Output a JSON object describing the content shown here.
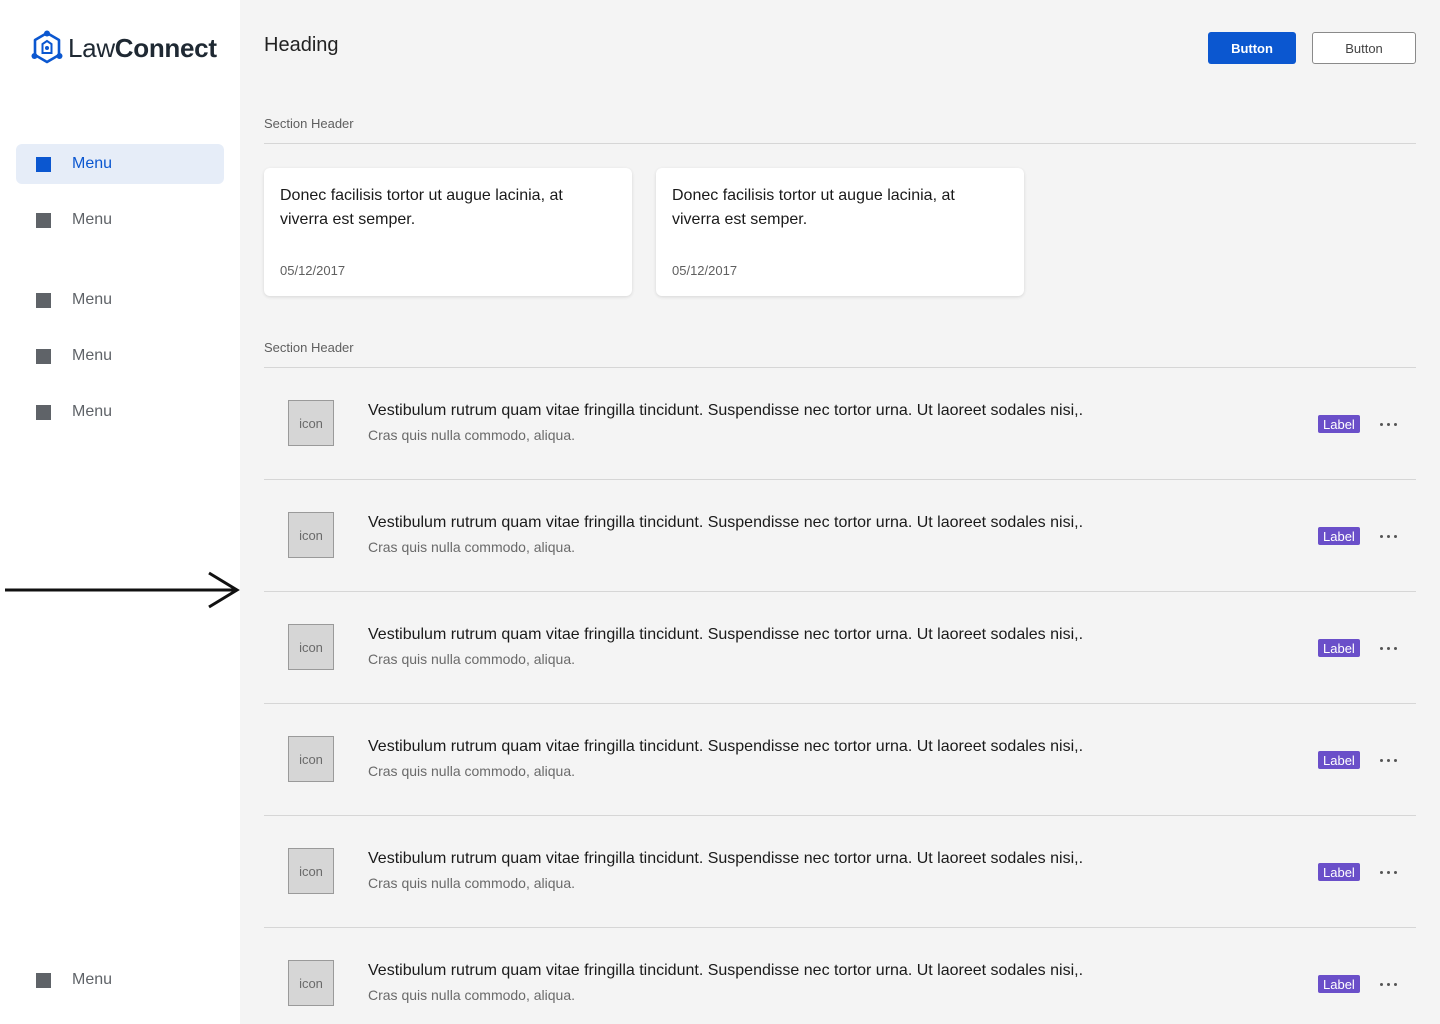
{
  "brand": {
    "name_light": "Law",
    "name_bold": "Connect",
    "color": "#0b57d0"
  },
  "sidebar": {
    "items": [
      {
        "label": "Menu",
        "active": true
      },
      {
        "label": "Menu",
        "active": false
      },
      {
        "label": "Menu",
        "active": false
      },
      {
        "label": "Menu",
        "active": false
      },
      {
        "label": "Menu",
        "active": false
      }
    ],
    "footer_item": {
      "label": "Menu"
    }
  },
  "header": {
    "title": "Heading",
    "primary_button": "Button",
    "secondary_button": "Button"
  },
  "sections": [
    {
      "title": "Section Header"
    },
    {
      "title": "Section Header"
    }
  ],
  "cards": [
    {
      "text": "Donec facilisis tortor ut augue lacinia, at viverra est semper.",
      "date": "05/12/2017"
    },
    {
      "text": "Donec facilisis tortor ut augue lacinia, at viverra est semper.",
      "date": "05/12/2017"
    }
  ],
  "list": {
    "items": [
      {
        "icon_text": "icon",
        "title": "Vestibulum rutrum quam vitae fringilla tincidunt. Suspendisse nec tortor urna. Ut laoreet sodales nisi,.",
        "subtitle": "Cras quis nulla commodo, aliqua.",
        "label": "Label"
      },
      {
        "icon_text": "icon",
        "title": "Vestibulum rutrum quam vitae fringilla tincidunt. Suspendisse nec tortor urna. Ut laoreet sodales nisi,.",
        "subtitle": "Cras quis nulla commodo, aliqua.",
        "label": "Label"
      },
      {
        "icon_text": "icon",
        "title": "Vestibulum rutrum quam vitae fringilla tincidunt. Suspendisse nec tortor urna. Ut laoreet sodales nisi,.",
        "subtitle": "Cras quis nulla commodo, aliqua.",
        "label": "Label"
      },
      {
        "icon_text": "icon",
        "title": "Vestibulum rutrum quam vitae fringilla tincidunt. Suspendisse nec tortor urna. Ut laoreet sodales nisi,.",
        "subtitle": "Cras quis nulla commodo, aliqua.",
        "label": "Label"
      },
      {
        "icon_text": "icon",
        "title": "Vestibulum rutrum quam vitae fringilla tincidunt. Suspendisse nec tortor urna. Ut laoreet sodales nisi,.",
        "subtitle": "Cras quis nulla commodo, aliqua.",
        "label": "Label"
      },
      {
        "icon_text": "icon",
        "title": "Vestibulum rutrum quam vitae fringilla tincidunt. Suspendisse nec tortor urna. Ut laoreet sodales nisi,.",
        "subtitle": "Cras quis nulla commodo, aliqua.",
        "label": "Label"
      }
    ]
  },
  "colors": {
    "accent": "#0b57d0",
    "label_badge": "#6a4fc9",
    "active_menu_bg": "#e6edf8",
    "page_bg": "#f4f4f4"
  },
  "icons": [
    "law-connect-logo-icon",
    "menu-square-icon",
    "more-horizontal-icon",
    "arrow-right-icon"
  ]
}
